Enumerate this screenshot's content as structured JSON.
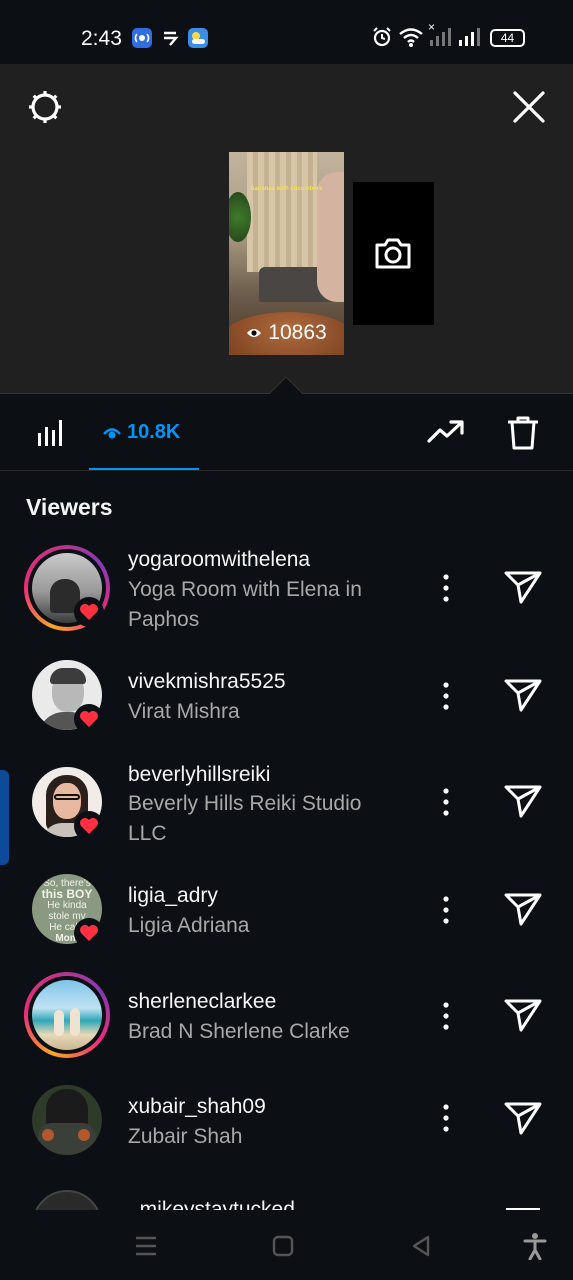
{
  "status_bar": {
    "time": "2:43",
    "battery": "44",
    "signal_x": "×"
  },
  "story": {
    "caption": "bananas with cucumbers",
    "views": "10863"
  },
  "tabs": {
    "views_count": "10.8K"
  },
  "viewers": {
    "title": "Viewers",
    "items": [
      {
        "username": "yogaroomwithelena",
        "name": "Yoga Room with Elena in Paphos",
        "name_line1": "Yoga Room with Elena in",
        "name_line2": "Paphos",
        "liked": true,
        "ring": true
      },
      {
        "username": "vivekmishra5525",
        "name": "Virat Mishra",
        "liked": true,
        "ring": false
      },
      {
        "username": "beverlyhillsreiki",
        "name": "Beverly Hills Reiki Studio LLC",
        "name_line1": "Beverly Hills Reiki Studio",
        "name_line2": "LLC",
        "liked": true,
        "ring": false
      },
      {
        "username": "ligia_adry",
        "name": "Ligia Adriana",
        "liked": true,
        "ring": false
      },
      {
        "username": "sherleneclarkee",
        "name": "Brad N Sherlene Clarke",
        "liked": false,
        "ring": true
      },
      {
        "username": "xubair_shah09",
        "name": "Zubair Shah",
        "liked": false,
        "ring": false
      },
      {
        "username": "_mikeystaytucked",
        "name": "",
        "liked": false,
        "ring": false
      }
    ],
    "avatar4_text": [
      "So, there's",
      "this BOY",
      "He kinda",
      "stole my",
      "He calls",
      "Mom"
    ]
  },
  "colors": {
    "accent": "#0095f6",
    "heart": "#ff3040",
    "background": "#0c1014",
    "secondary_text": "#a8a8a8"
  },
  "icons": [
    "settings-icon",
    "close-icon",
    "camera-icon",
    "bar-chart-icon",
    "eye-icon",
    "trend-icon",
    "trash-icon",
    "more-icon",
    "send-icon",
    "heart-icon",
    "menu-icon",
    "home-icon",
    "back-icon",
    "accessibility-icon"
  ]
}
